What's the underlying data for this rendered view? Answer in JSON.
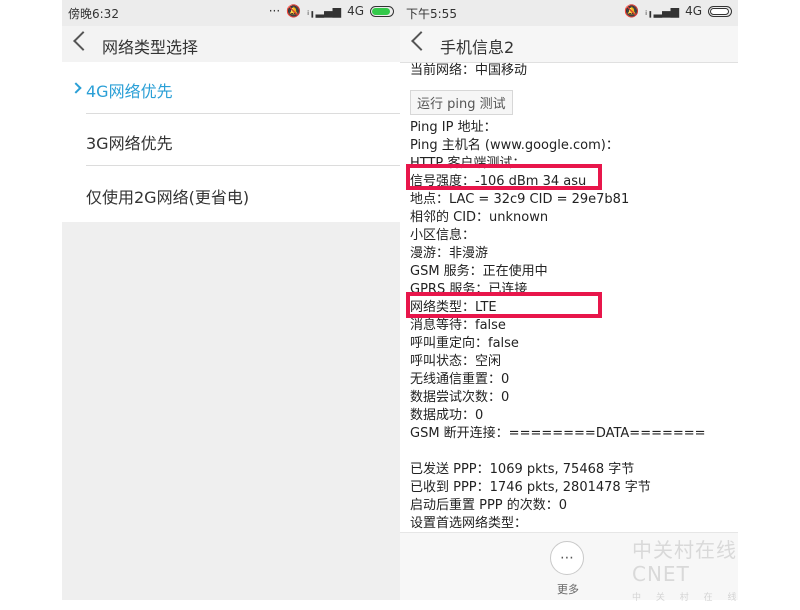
{
  "left": {
    "status": {
      "time": "傍晚6:32",
      "net": "4G"
    },
    "title": "网络类型选择",
    "options": [
      {
        "label": "4G网络优先",
        "selected": true
      },
      {
        "label": "3G网络优先",
        "selected": false
      },
      {
        "label": "仅使用2G网络(更省电)",
        "selected": false
      }
    ]
  },
  "right": {
    "status": {
      "time": "下午5:55",
      "net": "4G"
    },
    "title": "手机信息2",
    "current_network": "当前网络：中国移动",
    "ping_button": "运行 ping 测试",
    "rows": [
      "Ping IP 地址：",
      "Ping 主机名 (www.google.com)：",
      "HTTP 客户端测试：",
      "信号强度：-106 dBm  34 asu",
      "地点：LAC = 32c9  CID = 29e7b81",
      "相邻的 CID：unknown",
      "小区信息：",
      "漫游：非漫游",
      "GSM 服务：正在使用中",
      "GPRS 服务：已连接",
      "网络类型：LTE",
      "消息等待：false",
      "呼叫重定向：false",
      "呼叫状态：空闲",
      "无线通信重置：0",
      "数据尝试次数：0",
      "数据成功：0",
      "GSM 断开连接：========DATA=======",
      "",
      "已发送 PPP：1069 pkts, 75468 字节",
      "已收到 PPP：1746 pkts, 2801478 字节",
      "启动后重置 PPP 的次数：0",
      "设置首选网络类型："
    ],
    "more_label": "更多",
    "more_icon": "⋯"
  },
  "watermark": {
    "line1": "中关村在线 CNET",
    "line2": "中 关 村 在 线"
  },
  "colors": {
    "accent": "#2a9fd6",
    "highlight": "#e8164b"
  }
}
